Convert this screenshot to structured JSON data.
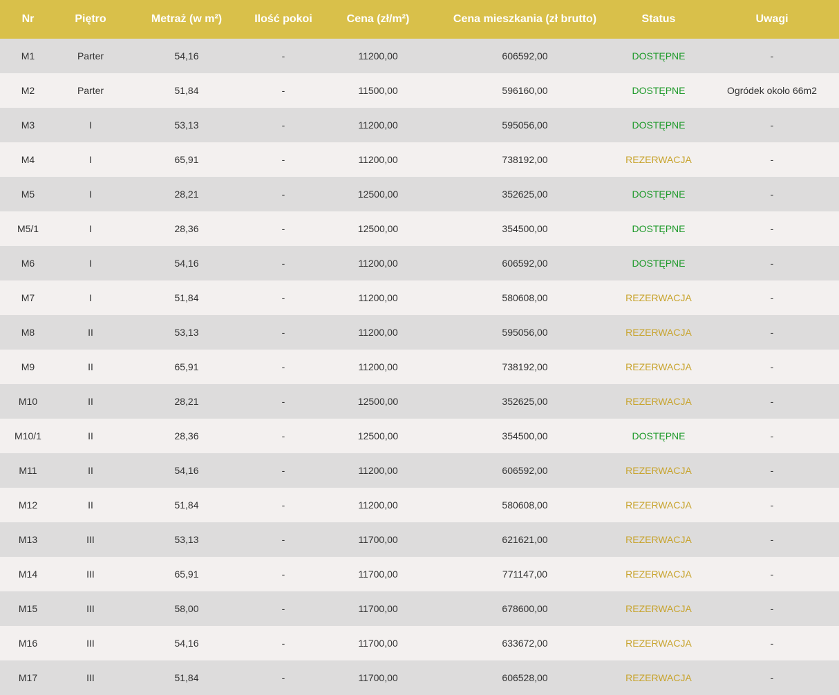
{
  "colors": {
    "header_bg": "#d9c04a",
    "row_odd": "#dddcdc",
    "row_even": "#f3f0ef",
    "available": "#1f9a2b",
    "reserved": "#c8a42e"
  },
  "headers": [
    "Nr",
    "Piętro",
    "Metraż (w m²)",
    "Ilość pokoi",
    "Cena (zł/m²)",
    "Cena mieszkania (zł brutto)",
    "Status",
    "Uwagi"
  ],
  "rows": [
    {
      "nr": "M1",
      "pietro": "Parter",
      "metraz": "54,16",
      "pokoje": "-",
      "cena": "11200,00",
      "cena_m": "606592,00",
      "status": "DOSTĘPNE",
      "uwagi": "-"
    },
    {
      "nr": "M2",
      "pietro": "Parter",
      "metraz": "51,84",
      "pokoje": "-",
      "cena": "11500,00",
      "cena_m": "596160,00",
      "status": "DOSTĘPNE",
      "uwagi": "Ogródek około 66m2"
    },
    {
      "nr": "M3",
      "pietro": "I",
      "metraz": "53,13",
      "pokoje": "-",
      "cena": "11200,00",
      "cena_m": "595056,00",
      "status": "DOSTĘPNE",
      "uwagi": "-"
    },
    {
      "nr": "M4",
      "pietro": "I",
      "metraz": "65,91",
      "pokoje": "-",
      "cena": "11200,00",
      "cena_m": "738192,00",
      "status": "REZERWACJA",
      "uwagi": "-"
    },
    {
      "nr": "M5",
      "pietro": "I",
      "metraz": "28,21",
      "pokoje": "-",
      "cena": "12500,00",
      "cena_m": "352625,00",
      "status": "DOSTĘPNE",
      "uwagi": "-"
    },
    {
      "nr": "M5/1",
      "pietro": "I",
      "metraz": "28,36",
      "pokoje": "-",
      "cena": "12500,00",
      "cena_m": "354500,00",
      "status": "DOSTĘPNE",
      "uwagi": "-"
    },
    {
      "nr": "M6",
      "pietro": "I",
      "metraz": "54,16",
      "pokoje": "-",
      "cena": "11200,00",
      "cena_m": "606592,00",
      "status": "DOSTĘPNE",
      "uwagi": "-"
    },
    {
      "nr": "M7",
      "pietro": "I",
      "metraz": "51,84",
      "pokoje": "-",
      "cena": "11200,00",
      "cena_m": "580608,00",
      "status": "REZERWACJA",
      "uwagi": "-"
    },
    {
      "nr": "M8",
      "pietro": "II",
      "metraz": "53,13",
      "pokoje": "-",
      "cena": "11200,00",
      "cena_m": "595056,00",
      "status": "REZERWACJA",
      "uwagi": "-"
    },
    {
      "nr": "M9",
      "pietro": "II",
      "metraz": "65,91",
      "pokoje": "-",
      "cena": "11200,00",
      "cena_m": "738192,00",
      "status": "REZERWACJA",
      "uwagi": "-"
    },
    {
      "nr": "M10",
      "pietro": "II",
      "metraz": "28,21",
      "pokoje": "-",
      "cena": "12500,00",
      "cena_m": "352625,00",
      "status": "REZERWACJA",
      "uwagi": "-"
    },
    {
      "nr": "M10/1",
      "pietro": "II",
      "metraz": "28,36",
      "pokoje": "-",
      "cena": "12500,00",
      "cena_m": "354500,00",
      "status": "DOSTĘPNE",
      "uwagi": "-"
    },
    {
      "nr": "M11",
      "pietro": "II",
      "metraz": "54,16",
      "pokoje": "-",
      "cena": "11200,00",
      "cena_m": "606592,00",
      "status": "REZERWACJA",
      "uwagi": "-"
    },
    {
      "nr": "M12",
      "pietro": "II",
      "metraz": "51,84",
      "pokoje": "-",
      "cena": "11200,00",
      "cena_m": "580608,00",
      "status": "REZERWACJA",
      "uwagi": "-"
    },
    {
      "nr": "M13",
      "pietro": "III",
      "metraz": "53,13",
      "pokoje": "-",
      "cena": "11700,00",
      "cena_m": "621621,00",
      "status": "REZERWACJA",
      "uwagi": "-"
    },
    {
      "nr": "M14",
      "pietro": "III",
      "metraz": "65,91",
      "pokoje": "-",
      "cena": "11700,00",
      "cena_m": "771147,00",
      "status": "REZERWACJA",
      "uwagi": "-"
    },
    {
      "nr": "M15",
      "pietro": "III",
      "metraz": "58,00",
      "pokoje": "-",
      "cena": "11700,00",
      "cena_m": "678600,00",
      "status": "REZERWACJA",
      "uwagi": "-"
    },
    {
      "nr": "M16",
      "pietro": "III",
      "metraz": "54,16",
      "pokoje": "-",
      "cena": "11700,00",
      "cena_m": "633672,00",
      "status": "REZERWACJA",
      "uwagi": "-"
    },
    {
      "nr": "M17",
      "pietro": "III",
      "metraz": "51,84",
      "pokoje": "-",
      "cena": "11700,00",
      "cena_m": "606528,00",
      "status": "REZERWACJA",
      "uwagi": "-"
    }
  ]
}
